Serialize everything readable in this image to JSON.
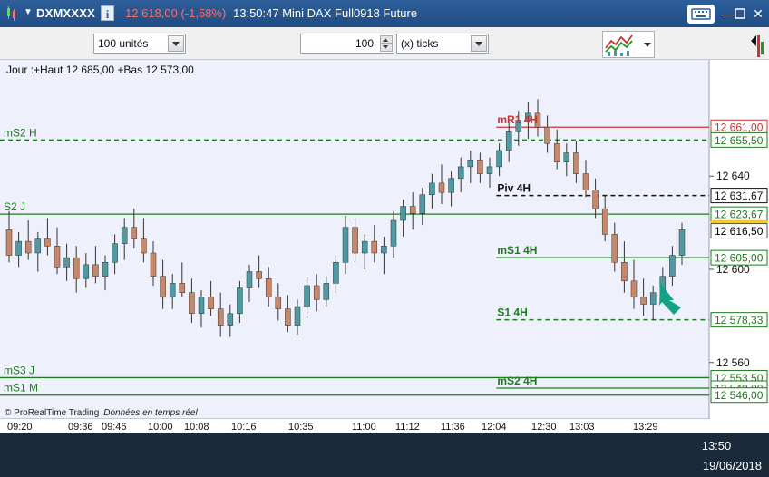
{
  "titlebar": {
    "symbol": "DXMXXXX",
    "info_icon": "info-icon",
    "price_change": "12 618,00 (-1,58%)",
    "time_description": "13:50:47 Mini DAX Full0918 Future"
  },
  "toolbar": {
    "quantity_unit": "100 unités",
    "ticks_value": "100",
    "ticks_unit": "(x) ticks"
  },
  "chart": {
    "header": "Jour :+Haut 12 685,00 +Bas 12 573,00",
    "footer_brand": "© ProRealTime Trading",
    "footer_note": "Données en temps réel",
    "colors": {
      "up": "#4f9aa0",
      "down": "#c7886a",
      "support": "#1e7a1e",
      "resistance": "#d03030",
      "pivot": "#111111",
      "arrow": "#12a385",
      "current_price": "#ffcc00"
    }
  },
  "chart_data": {
    "type": "candlestick",
    "title": "Jour :+Haut 12 685,00 +Bas 12 573,00",
    "y_axis_ticks": [
      12640,
      12600,
      12560
    ],
    "y_axis_tick_labels": [
      "12 640",
      "12 600",
      "12 560"
    ],
    "ylim": [
      12542,
      12686
    ],
    "x_axis_ticks": [
      "09:20",
      "09:36",
      "09:46",
      "10:00",
      "10:08",
      "10:16",
      "10:35",
      "11:00",
      "11:12",
      "11:36",
      "12:04",
      "12:30",
      "13:03",
      "13:29"
    ],
    "current_price": {
      "value": 12618.0,
      "label": "12 618,00"
    },
    "last_close": {
      "value": 12616.5,
      "label": "12 616,50"
    },
    "levels": [
      {
        "name": "mR1 4H",
        "value": 12661.0,
        "label": "12 661,00",
        "style": "solid",
        "color": "#d03030",
        "start": 0.7
      },
      {
        "name": "mS2 H",
        "value": 12655.5,
        "label": "12 655,50",
        "style": "dashed",
        "color": "#1e7a1e",
        "start": 0.0
      },
      {
        "name": "Piv 4H",
        "value": 12631.67,
        "label": "12 631,67",
        "style": "dashed",
        "color": "#111111",
        "start": 0.7
      },
      {
        "name": "S2 J",
        "value": 12623.67,
        "label": "12 623,67",
        "style": "solid",
        "color": "#1e7a1e",
        "start": 0.0
      },
      {
        "name": "mS1 4H",
        "value": 12605.0,
        "label": "12 605,00",
        "style": "solid",
        "color": "#1e7a1e",
        "start": 0.7
      },
      {
        "name": "S1 4H",
        "value": 12578.33,
        "label": "12 578,33",
        "style": "dashed",
        "color": "#1e7a1e",
        "start": 0.7
      },
      {
        "name": "mS3 J",
        "value": 12553.5,
        "label": "12 553,50",
        "style": "solid",
        "color": "#1e7a1e",
        "start": 0.0
      },
      {
        "name": "mS2 4H",
        "value": 12549.0,
        "label": "12 549,00",
        "style": "solid",
        "color": "#1e7a1e",
        "start": 0.7
      },
      {
        "name": "mS1 M",
        "value": 12546.0,
        "label": "12 546,00",
        "style": "solid",
        "color": "#1e7a1e",
        "start": 0.0
      }
    ],
    "candles": [
      [
        12617,
        12625,
        12603,
        12606
      ],
      [
        12606,
        12616,
        12601,
        12612
      ],
      [
        12612,
        12621,
        12604,
        12607
      ],
      [
        12607,
        12616,
        12599,
        12613
      ],
      [
        12613,
        12622,
        12606,
        12610
      ],
      [
        12610,
        12618,
        12598,
        12601
      ],
      [
        12601,
        12611,
        12595,
        12605
      ],
      [
        12605,
        12610,
        12590,
        12596
      ],
      [
        12596,
        12607,
        12592,
        12602
      ],
      [
        12602,
        12610,
        12594,
        12597
      ],
      [
        12597,
        12606,
        12591,
        12603
      ],
      [
        12603,
        12615,
        12598,
        12611
      ],
      [
        12611,
        12622,
        12604,
        12618
      ],
      [
        12618,
        12626,
        12609,
        12613
      ],
      [
        12613,
        12622,
        12603,
        12607
      ],
      [
        12607,
        12612,
        12593,
        12597
      ],
      [
        12597,
        12604,
        12583,
        12588
      ],
      [
        12588,
        12598,
        12583,
        12594
      ],
      [
        12594,
        12603,
        12588,
        12590
      ],
      [
        12590,
        12596,
        12577,
        12581
      ],
      [
        12581,
        12591,
        12575,
        12588
      ],
      [
        12588,
        12595,
        12580,
        12583
      ],
      [
        12583,
        12590,
        12571,
        12576
      ],
      [
        12576,
        12585,
        12571,
        12581
      ],
      [
        12581,
        12595,
        12577,
        12592
      ],
      [
        12592,
        12602,
        12586,
        12599
      ],
      [
        12599,
        12606,
        12592,
        12596
      ],
      [
        12596,
        12601,
        12584,
        12588
      ],
      [
        12588,
        12594,
        12578,
        12583
      ],
      [
        12583,
        12589,
        12573,
        12576
      ],
      [
        12576,
        12587,
        12572,
        12584
      ],
      [
        12584,
        12597,
        12579,
        12593
      ],
      [
        12593,
        12598,
        12582,
        12587
      ],
      [
        12587,
        12597,
        12584,
        12594
      ],
      [
        12594,
        12606,
        12590,
        12603
      ],
      [
        12603,
        12623,
        12598,
        12618
      ],
      [
        12618,
        12622,
        12603,
        12607
      ],
      [
        12607,
        12615,
        12600,
        12612
      ],
      [
        12612,
        12619,
        12603,
        12607
      ],
      [
        12607,
        12614,
        12598,
        12610
      ],
      [
        12610,
        12625,
        12605,
        12621
      ],
      [
        12621,
        12630,
        12614,
        12627
      ],
      [
        12627,
        12633,
        12617,
        12624
      ],
      [
        12624,
        12635,
        12619,
        12632
      ],
      [
        12632,
        12641,
        12626,
        12637
      ],
      [
        12637,
        12645,
        12628,
        12633
      ],
      [
        12633,
        12642,
        12627,
        12639
      ],
      [
        12639,
        12648,
        12633,
        12644
      ],
      [
        12644,
        12651,
        12637,
        12647
      ],
      [
        12647,
        12650,
        12637,
        12641
      ],
      [
        12641,
        12648,
        12635,
        12644
      ],
      [
        12644,
        12654,
        12640,
        12651
      ],
      [
        12651,
        12663,
        12646,
        12659
      ],
      [
        12659,
        12668,
        12653,
        12664
      ],
      [
        12664,
        12672,
        12656,
        12667
      ],
      [
        12667,
        12673,
        12657,
        12661
      ],
      [
        12661,
        12666,
        12650,
        12654
      ],
      [
        12654,
        12660,
        12643,
        12646
      ],
      [
        12646,
        12654,
        12640,
        12650
      ],
      [
        12650,
        12655,
        12637,
        12641
      ],
      [
        12641,
        12647,
        12631,
        12634
      ],
      [
        12634,
        12639,
        12622,
        12626
      ],
      [
        12626,
        12632,
        12612,
        12615
      ],
      [
        12615,
        12620,
        12599,
        12603
      ],
      [
        12603,
        12612,
        12590,
        12595
      ],
      [
        12595,
        12604,
        12583,
        12588
      ],
      [
        12588,
        12596,
        12580,
        12585
      ],
      [
        12585,
        12593,
        12578,
        12590
      ],
      [
        12590,
        12601,
        12586,
        12597
      ],
      [
        12597,
        12610,
        12593,
        12606
      ],
      [
        12606,
        12620,
        12602,
        12617
      ]
    ]
  },
  "taskbar": {
    "clock": "13:50",
    "date": "19/06/2018"
  }
}
